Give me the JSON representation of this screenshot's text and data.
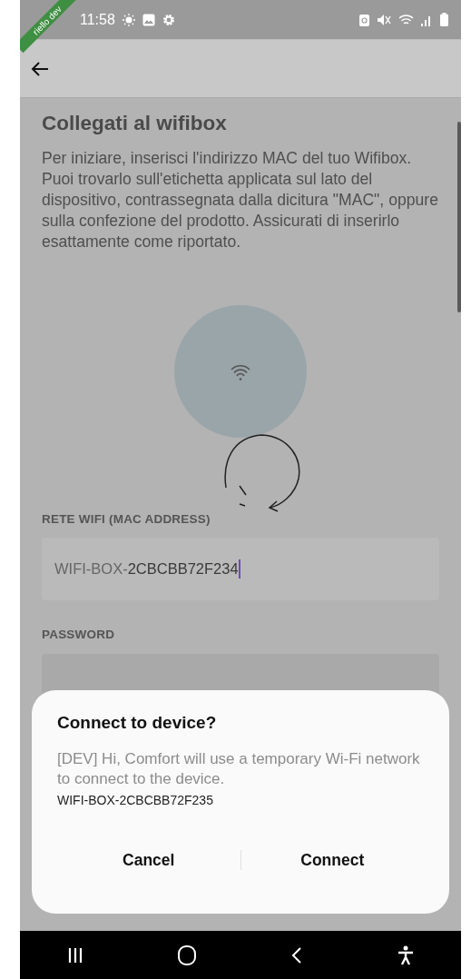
{
  "status_bar": {
    "time": "11:58"
  },
  "debug_ribbon": {
    "text": "riello dev"
  },
  "page": {
    "title": "Collegati al wifibox",
    "description": "Per iniziare, inserisci l'indirizzo MAC del tuo Wifibox. Puoi trovarlo sull'etichetta applicata sul lato del dispositivo, contrassegnata dalla dicitura \"MAC\", oppure sulla confezione del prodotto. Assicurati di inserirlo esattamente come riportato."
  },
  "fields": [
    {
      "kind": "mac",
      "label": "RETE WIFI (MAC ADDRESS)",
      "prefix": "WIFI-BOX-",
      "value": "2CBCBB72F234",
      "focused": true
    },
    {
      "kind": "password",
      "label": "PASSWORD"
    }
  ],
  "dialog": {
    "title": "Connect to device?",
    "message": "[DEV] Hi, Comfort will use a temporary Wi-Fi network to connect to the device.",
    "network": "WIFI-BOX-2CBCBB72F235",
    "buttons": [
      "Cancel",
      "Connect"
    ]
  }
}
